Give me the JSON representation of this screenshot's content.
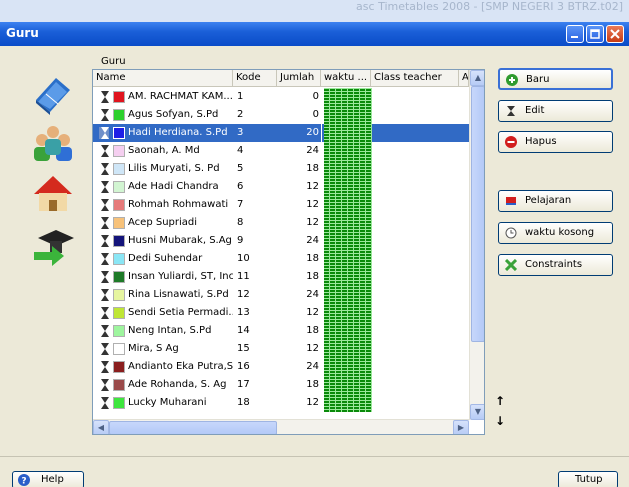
{
  "background_app": {
    "title": "asc Timetables 2008 - [SMP NEGERI 3 BTRZ.t02]"
  },
  "window": {
    "title": "Guru"
  },
  "grid": {
    "label": "Guru",
    "columns": [
      "Name",
      "Kode",
      "Jumlah",
      "waktu ...",
      "Class teacher",
      "A"
    ],
    "rows": [
      {
        "name": "AM. RACHMAT KAM...",
        "kode": "1",
        "jumlah": "0",
        "color": "#e0141e"
      },
      {
        "name": "Agus Sofyan, S.Pd",
        "kode": "2",
        "jumlah": "0",
        "color": "#2dd02d"
      },
      {
        "name": "Hadi Herdiana. S.Pd",
        "kode": "3",
        "jumlah": "20",
        "color": "#1e1ee6",
        "selected": true
      },
      {
        "name": "Saonah, A. Md",
        "kode": "4",
        "jumlah": "24",
        "color": "#f5cff0"
      },
      {
        "name": "Lilis Muryati, S. Pd",
        "kode": "5",
        "jumlah": "18",
        "color": "#cfe6f7"
      },
      {
        "name": "Ade Hadi Chandra",
        "kode": "6",
        "jumlah": "12",
        "color": "#d2f5d2"
      },
      {
        "name": "Rohmah Rohmawati",
        "kode": "7",
        "jumlah": "12",
        "color": "#e67a7a"
      },
      {
        "name": "Acep Supriadi",
        "kode": "8",
        "jumlah": "12",
        "color": "#f7c27a"
      },
      {
        "name": "Husni Mubarak, S.Ag",
        "kode": "9",
        "jumlah": "24",
        "color": "#14147a"
      },
      {
        "name": "Dedi Suhendar",
        "kode": "10",
        "jumlah": "18",
        "color": "#8ae6f5"
      },
      {
        "name": "Insan Yuliardi, ST, Inc",
        "kode": "11",
        "jumlah": "18",
        "color": "#1e7a28"
      },
      {
        "name": "Rina Lisnawati, S.Pd",
        "kode": "12",
        "jumlah": "24",
        "color": "#e6f5a0"
      },
      {
        "name": "Sendi Setia Permadi...",
        "kode": "13",
        "jumlah": "12",
        "color": "#bfe635"
      },
      {
        "name": "Neng Intan, S.Pd",
        "kode": "14",
        "jumlah": "18",
        "color": "#9ef59e"
      },
      {
        "name": "Mira, S Ag",
        "kode": "15",
        "jumlah": "12",
        "color": "#ffffff"
      },
      {
        "name": "Andianto Eka Putra,S.Si",
        "kode": "16",
        "jumlah": "24",
        "color": "#8a1e1e"
      },
      {
        "name": "Ade Rohanda, S. Ag",
        "kode": "17",
        "jumlah": "18",
        "color": "#9a4a4a"
      },
      {
        "name": "Lucky Muharani",
        "kode": "18",
        "jumlah": "12",
        "color": "#3ee63e"
      }
    ]
  },
  "buttons": {
    "baru": "Baru",
    "edit": "Edit",
    "hapus": "Hapus",
    "pelajaran": "Pelajaran",
    "waktu_kosong": "waktu kosong",
    "constraints": "Constraints",
    "move_up": "↑",
    "move_down": "↓",
    "help": "Help",
    "tutup": "Tutup"
  }
}
